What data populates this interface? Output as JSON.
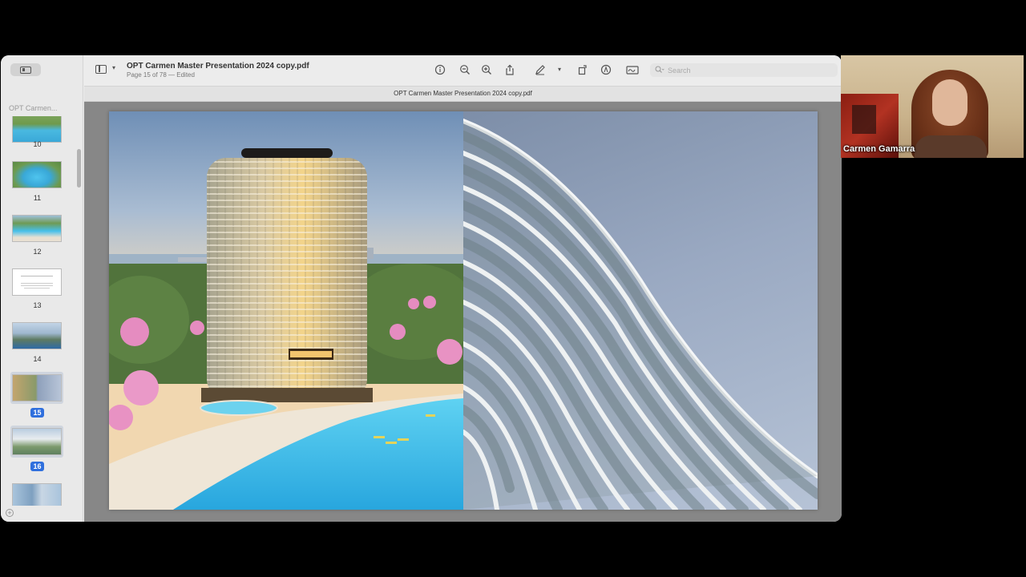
{
  "window": {
    "doc_title": "OPT Carmen Master Presentation 2024 copy.pdf",
    "doc_subtitle": "Page 15 of 78 — Edited",
    "tab_title": "OPT Carmen Master Presentation 2024 copy.pdf"
  },
  "sidebar": {
    "title": "OPT Carmen...",
    "thumbnails": [
      {
        "page": "10",
        "selected": false
      },
      {
        "page": "11",
        "selected": false
      },
      {
        "page": "12",
        "selected": false
      },
      {
        "page": "13",
        "selected": false
      },
      {
        "page": "14",
        "selected": false
      },
      {
        "page": "15",
        "selected": true
      },
      {
        "page": "16",
        "selected": true
      },
      {
        "page": "",
        "selected": false
      }
    ]
  },
  "toolbar": {
    "search_placeholder": "Search",
    "icons": [
      "info-icon",
      "zoom-out-icon",
      "zoom-in-icon",
      "share-icon",
      "markup-pen-icon",
      "rotate-icon",
      "highlight-icon",
      "sign-icon",
      "search-icon"
    ]
  },
  "video": {
    "participant_name": "Carmen Gamarra"
  },
  "colors": {
    "selection_blue": "#2f6fdd",
    "pool_blue": "#3ab3e6",
    "background": "#000000"
  }
}
